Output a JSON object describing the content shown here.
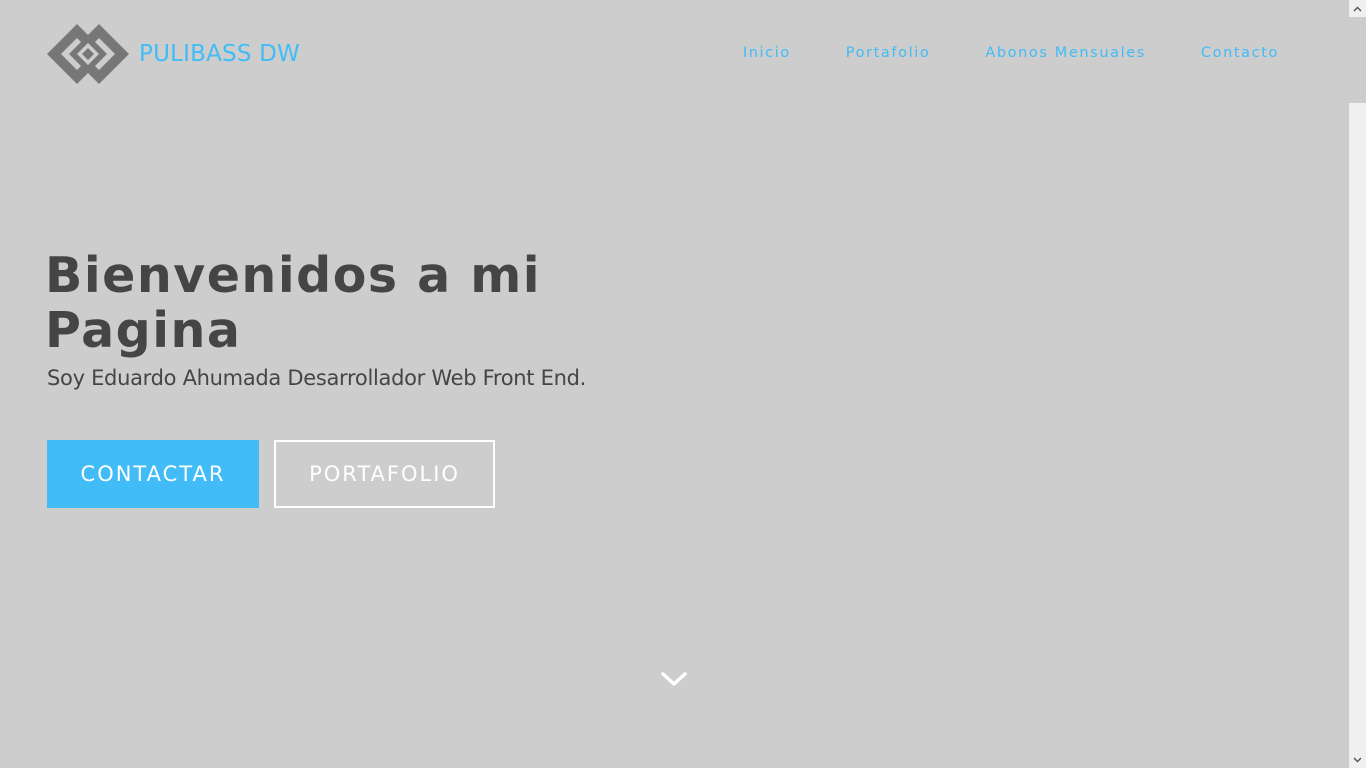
{
  "header": {
    "brand": "PULIBASS DW",
    "logo_icon": "interlocking-diamonds-logo",
    "nav": [
      {
        "label": "Inicio"
      },
      {
        "label": "Portafolio"
      },
      {
        "label": "Abonos Mensuales"
      },
      {
        "label": "Contacto"
      }
    ]
  },
  "hero": {
    "title": "Bienvenidos a mi Pagina",
    "subtitle": "Soy Eduardo Ahumada Desarrollador Web Front End.",
    "primary_button": "CONTACTAR",
    "secondary_button": "PORTAFOLIO",
    "scroll_icon": "chevron-down-icon"
  },
  "colors": {
    "accent": "#41bcf6",
    "background": "#cdcdcd",
    "text": "#454545",
    "logo_gray": "#777777"
  }
}
